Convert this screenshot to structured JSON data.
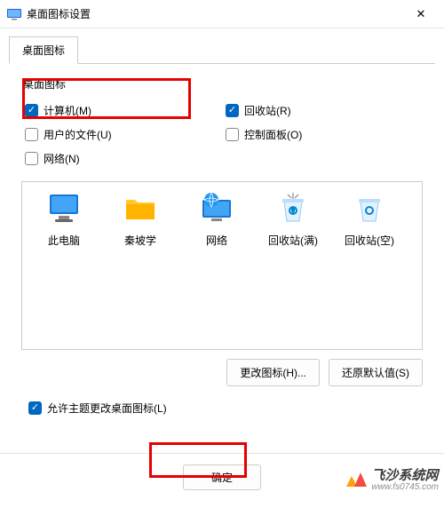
{
  "window": {
    "title": "桌面图标设置"
  },
  "tab": {
    "label": "桌面图标"
  },
  "group": {
    "label": "桌面图标"
  },
  "checks": {
    "computer": {
      "label": "计算机(M)",
      "checked": true
    },
    "recycle": {
      "label": "回收站(R)",
      "checked": true
    },
    "userfiles": {
      "label": "用户的文件(U)",
      "checked": false
    },
    "controlpanel": {
      "label": "控制面板(O)",
      "checked": false
    },
    "network": {
      "label": "网络(N)",
      "checked": false
    }
  },
  "icons": {
    "thispc": "此电脑",
    "qinpoxue": "秦坡学",
    "network": "网络",
    "recycle_full": "回收站(满)",
    "recycle_empty": "回收站(空)"
  },
  "buttons": {
    "change_icon": "更改图标(H)...",
    "restore_default": "还原默认值(S)",
    "ok": "确定"
  },
  "allow_theme": {
    "label": "允许主题更改桌面图标(L)",
    "checked": true
  },
  "watermark": {
    "name": "飞沙系统网",
    "url": "www.fs0745.com"
  }
}
